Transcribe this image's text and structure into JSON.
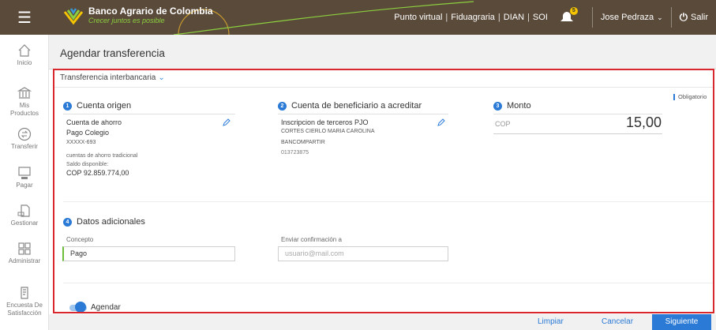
{
  "header": {
    "brand": "Banco Agrario de Colombia",
    "tagline": "Crecer juntos es posible",
    "links": [
      "Punto virtual",
      "Fiduagraria",
      "DIAN",
      "SOI"
    ],
    "notification_count": "5",
    "user_name": "Jose Pedraza",
    "logout_label": "Salir"
  },
  "sidebar": {
    "items": [
      {
        "label": "Inicio",
        "icon": "home-icon"
      },
      {
        "label": "Mis Productos",
        "icon": "bank-icon"
      },
      {
        "label": "Transferir",
        "icon": "transfer-icon"
      },
      {
        "label": "Pagar",
        "icon": "pay-icon"
      },
      {
        "label": "Gestionar",
        "icon": "manage-icon"
      },
      {
        "label": "Administrar",
        "icon": "grid-icon"
      },
      {
        "label": "Encuesta De Satisfacción",
        "icon": "survey-icon"
      }
    ]
  },
  "page": {
    "title": "Agendar transferencia",
    "transfer_type": "Transferencia interbancaria",
    "required_label": "Obligatorio"
  },
  "origin": {
    "heading": "Cuenta origen",
    "number": "1",
    "account_type": "Cuenta de ahorro",
    "account_name": "Pago Colegio",
    "account_number": "XXXXX-693",
    "account_desc": "cuentas de ahorro tradicional",
    "balance_label": "Saldo disponible:",
    "balance_value": "COP 92.859.774,00"
  },
  "beneficiary": {
    "heading": "Cuenta de beneficiario a acreditar",
    "number": "2",
    "registration": "Inscripcion de terceros PJO",
    "name": "CORTES CIERLO MARIA CAROLINA",
    "bank": "BANCOMPARTIR",
    "account": "013723875"
  },
  "amount": {
    "heading": "Monto",
    "number": "3",
    "currency": "COP",
    "value": "15,00"
  },
  "additional": {
    "heading": "Datos adicionales",
    "number": "4",
    "concept_label": "Concepto",
    "concept_value": "Pago",
    "confirm_label": "Enviar confirmación a",
    "confirm_placeholder": "usuario@mail.com"
  },
  "schedule": {
    "label": "Agendar"
  },
  "footer": {
    "clear": "Limpiar",
    "cancel": "Cancelar",
    "next": "Siguiente"
  },
  "colors": {
    "topbar": "#5a4a3a",
    "accent": "#2a7ad6",
    "highlight": "#d9272e",
    "green": "#6bbd3a"
  }
}
